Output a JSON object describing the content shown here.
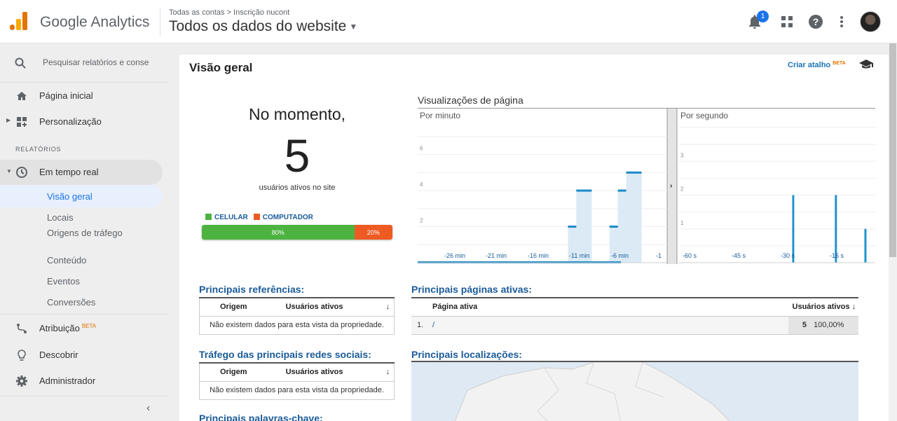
{
  "header": {
    "brand": "Google Analytics",
    "breadcrumb": "Todas as contas > Inscrição nucont",
    "property": "Todos os dados do website",
    "notification_count": "1"
  },
  "sidebar": {
    "search_placeholder": "Pesquisar relatórios e conse",
    "home": "Página inicial",
    "customization": "Personalização",
    "section_reports": "RELATÓRIOS",
    "realtime": "Em tempo real",
    "realtime_children": [
      "Visão geral",
      "Locais",
      "Origens de tráfego",
      "Conteúdo",
      "Eventos",
      "Conversões"
    ],
    "attribution": "Atribuição",
    "attribution_beta": "BETA",
    "discover": "Descobrir",
    "admin": "Administrador"
  },
  "main": {
    "title": "Visão geral",
    "shortcut_label": "Criar atalho",
    "shortcut_beta": "BETA",
    "now_label": "No momento,",
    "active_users": "5",
    "active_users_sub": "usuários ativos no site",
    "device_legend": [
      "CELULAR",
      "COMPUTADOR"
    ],
    "device_colors": [
      "#4cb340",
      "#ed5b23"
    ],
    "device_shares": [
      80,
      20
    ],
    "device_share_labels": [
      "80%",
      "20%"
    ],
    "pageviews_title": "Visualizações de página",
    "referrals_title": "Principais referências:",
    "referrals_cols": [
      "Origem",
      "Usuários ativos"
    ],
    "no_data": "Não existem dados para esta vista da propriedade.",
    "social_title": "Tráfego das principais redes sociais:",
    "social_cols": [
      "Origem",
      "Usuários ativos"
    ],
    "keywords_title": "Principais palavras-chave:",
    "active_pages_title": "Principais páginas ativas:",
    "active_pages_cols": [
      "Página ativa",
      "Usuários ativos"
    ],
    "active_pages_rows": [
      {
        "rank": "1.",
        "page": "/",
        "users": "5",
        "pct": "100,00%"
      }
    ],
    "locations_title": "Principais localizações:"
  },
  "chart_data": [
    {
      "type": "bar",
      "title": "Por minuto",
      "x_ticks": [
        "-26 min",
        "-21 min",
        "-16 min",
        "-11 min",
        "-6 min",
        "-1"
      ],
      "x_range": [
        -30,
        0
      ],
      "y_ticks": [
        2,
        4,
        6
      ],
      "ylim": [
        0,
        7.5
      ],
      "x": [
        -11,
        -10,
        -6,
        -5,
        -4
      ],
      "values": [
        2,
        4,
        2,
        4,
        5
      ]
    },
    {
      "type": "bar",
      "title": "Por segundo",
      "x_ticks": [
        "-60 s",
        "-45 s",
        "-30 s",
        "-15 s"
      ],
      "x_range": [
        -60,
        0
      ],
      "y_ticks": [
        1,
        2,
        3
      ],
      "ylim": [
        0,
        4
      ],
      "x": [
        -25,
        -12,
        -3
      ],
      "values": [
        2,
        2,
        1
      ]
    }
  ]
}
